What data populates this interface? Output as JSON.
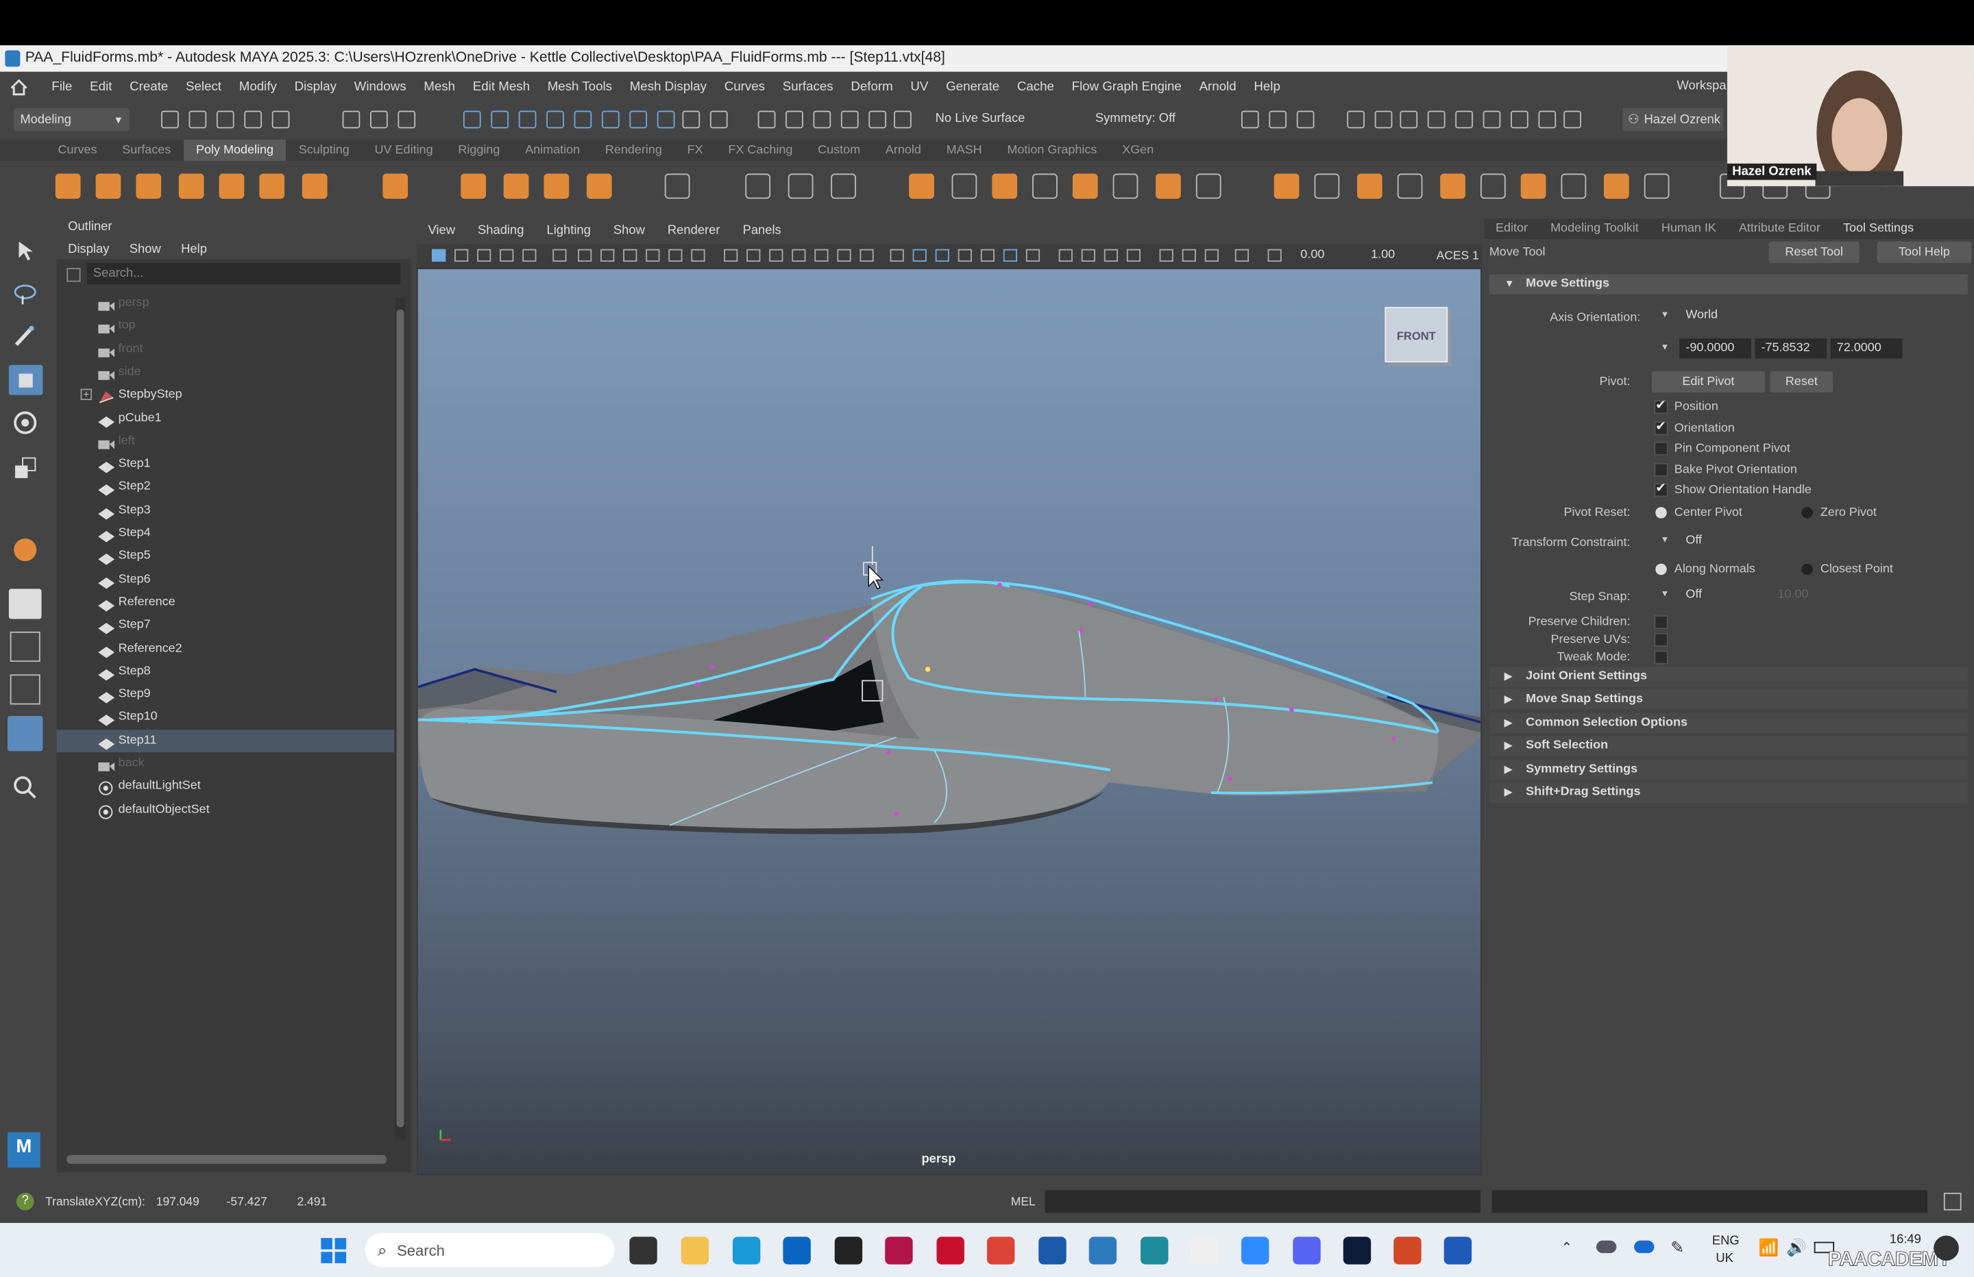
{
  "window": {
    "title": "PAA_FluidForms.mb* - Autodesk MAYA 2025.3: C:\\Users\\HOzrenk\\OneDrive - Kettle Collective\\Desktop\\PAA_FluidForms.mb   ---   [Step11.vtx[48]"
  },
  "menubar": [
    "File",
    "Edit",
    "Create",
    "Select",
    "Modify",
    "Display",
    "Windows",
    "Mesh",
    "Edit Mesh",
    "Mesh Tools",
    "Mesh Display",
    "Curves",
    "Surfaces",
    "Deform",
    "UV",
    "Generate",
    "Cache",
    "Flow Graph Engine",
    "Arnold",
    "Help"
  ],
  "workspace_label": "Workspa",
  "status_line": {
    "mode": "Modeling",
    "live_surface": "No Live Surface",
    "symmetry": "Symmetry: Off",
    "user": "Hazel Ozrenk"
  },
  "shelf_tabs": [
    "Curves",
    "Surfaces",
    "Poly Modeling",
    "Sculpting",
    "UV Editing",
    "Rigging",
    "Animation",
    "Rendering",
    "FX",
    "FX Caching",
    "Custom",
    "Arnold",
    "MASH",
    "Motion Graphics",
    "XGen"
  ],
  "shelf_active": "Poly Modeling",
  "webcam": {
    "name": "Hazel Ozrenk"
  },
  "outliner": {
    "title": "Outliner",
    "menu": [
      "Display",
      "Show",
      "Help"
    ],
    "search_placeholder": "Search...",
    "items": [
      {
        "label": "persp",
        "type": "camera",
        "dim": true
      },
      {
        "label": "top",
        "type": "camera",
        "dim": true
      },
      {
        "label": "front",
        "type": "camera",
        "dim": true
      },
      {
        "label": "side",
        "type": "camera",
        "dim": true
      },
      {
        "label": "StepbyStep",
        "type": "group",
        "expand": true
      },
      {
        "label": "pCube1",
        "type": "mesh"
      },
      {
        "label": "left",
        "type": "camera",
        "dim": true
      },
      {
        "label": "Step1",
        "type": "mesh"
      },
      {
        "label": "Step2",
        "type": "mesh"
      },
      {
        "label": "Step3",
        "type": "mesh"
      },
      {
        "label": "Step4",
        "type": "mesh"
      },
      {
        "label": "Step5",
        "type": "mesh"
      },
      {
        "label": "Step6",
        "type": "mesh"
      },
      {
        "label": "Reference",
        "type": "mesh"
      },
      {
        "label": "Step7",
        "type": "mesh"
      },
      {
        "label": "Reference2",
        "type": "mesh"
      },
      {
        "label": "Step8",
        "type": "mesh"
      },
      {
        "label": "Step9",
        "type": "mesh"
      },
      {
        "label": "Step10",
        "type": "mesh"
      },
      {
        "label": "Step11",
        "type": "mesh",
        "selected": true
      },
      {
        "label": "back",
        "type": "camera",
        "dim": true
      },
      {
        "label": "defaultLightSet",
        "type": "set"
      },
      {
        "label": "defaultObjectSet",
        "type": "set"
      }
    ]
  },
  "viewport": {
    "menu": [
      "View",
      "Shading",
      "Lighting",
      "Show",
      "Renderer",
      "Panels"
    ],
    "exposure": "0.00",
    "gamma": "1.00",
    "color_space": "ACES 1",
    "view_cube_label": "FRONT",
    "camera_label": "persp"
  },
  "attribute_panel": {
    "tabs": [
      "Editor",
      "Modeling Toolkit",
      "Human IK",
      "Attribute Editor",
      "Tool Settings"
    ],
    "active_tab": "Tool Settings",
    "tool_name": "Move Tool",
    "reset_tool": "Reset Tool",
    "tool_help": "Tool Help",
    "move_settings": "Move Settings",
    "axis_orientation_label": "Axis Orientation:",
    "axis_orientation_value": "World",
    "axis_values": [
      "-90.0000",
      "-75.8532",
      "72.0000"
    ],
    "pivot_label": "Pivot:",
    "edit_pivot": "Edit Pivot",
    "reset": "Reset",
    "checks": [
      {
        "label": "Position",
        "checked": true
      },
      {
        "label": "Orientation",
        "checked": true
      },
      {
        "label": "Pin Component Pivot",
        "checked": false
      },
      {
        "label": "Bake Pivot Orientation",
        "checked": false
      },
      {
        "label": "Show Orientation Handle",
        "checked": true
      }
    ],
    "pivot_reset_label": "Pivot Reset:",
    "center_pivot": "Center Pivot",
    "zero_pivot": "Zero Pivot",
    "transform_constraint_label": "Transform Constraint:",
    "transform_constraint_value": "Off",
    "along_normals": "Along Normals",
    "closest_point": "Closest Point",
    "step_snap_label": "Step Snap:",
    "step_snap_value": "Off",
    "step_snap_amount": "10.00",
    "preserve_children": "Preserve Children:",
    "preserve_uvs": "Preserve UVs:",
    "tweak_mode": "Tweak Mode:",
    "sections": [
      "Joint Orient Settings",
      "Move Snap Settings",
      "Common Selection Options",
      "Soft Selection",
      "Symmetry Settings",
      "Shift+Drag Settings"
    ]
  },
  "command_line": {
    "readout_label": "TranslateXYZ(cm):",
    "x": "197.049",
    "y": "-57.427",
    "z": "2.491",
    "language": "MEL"
  },
  "taskbar": {
    "search": "Search",
    "lang_top": "ENG",
    "lang_bottom": "UK",
    "time": "16:49",
    "watermark": "PAACADEMY"
  },
  "colors": {
    "accent_orange": "#e08a3a",
    "wire_blue": "#6ad8ff",
    "selection": "#4d5866"
  }
}
